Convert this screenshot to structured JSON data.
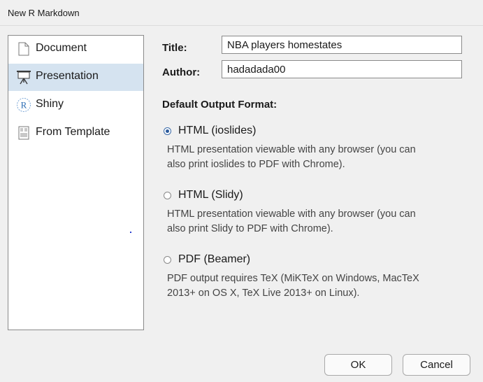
{
  "window": {
    "title": "New R Markdown"
  },
  "sidebar": {
    "items": [
      {
        "label": "Document",
        "icon": "document-icon",
        "selected": false
      },
      {
        "label": "Presentation",
        "icon": "presentation-icon",
        "selected": true
      },
      {
        "label": "Shiny",
        "icon": "shiny-r-icon",
        "selected": false
      },
      {
        "label": "From Template",
        "icon": "template-icon",
        "selected": false
      }
    ]
  },
  "form": {
    "title_label": "Title:",
    "title_value": "NBA players homestates",
    "author_label": "Author:",
    "author_value": "hadadada00"
  },
  "output": {
    "heading": "Default Output Format:",
    "options": [
      {
        "label": "HTML (ioslides)",
        "checked": true,
        "desc_line1": "HTML presentation viewable with any browser (you can",
        "desc_line2": "also print ioslides to PDF with Chrome)."
      },
      {
        "label": "HTML (Slidy)",
        "checked": false,
        "desc_line1": "HTML presentation viewable with any browser (you can",
        "desc_line2": "also print Slidy to PDF with Chrome)."
      },
      {
        "label": "PDF (Beamer)",
        "checked": false,
        "desc_line1": "PDF output requires TeX (MiKTeX on Windows, MacTeX",
        "desc_line2": "2013+ on OS X, TeX Live 2013+ on Linux)."
      }
    ]
  },
  "buttons": {
    "ok": "OK",
    "cancel": "Cancel"
  },
  "colors": {
    "selection": "#d5e3f0",
    "radio_checked": "#2b5a9c",
    "window_bg": "#f0f0f0"
  }
}
